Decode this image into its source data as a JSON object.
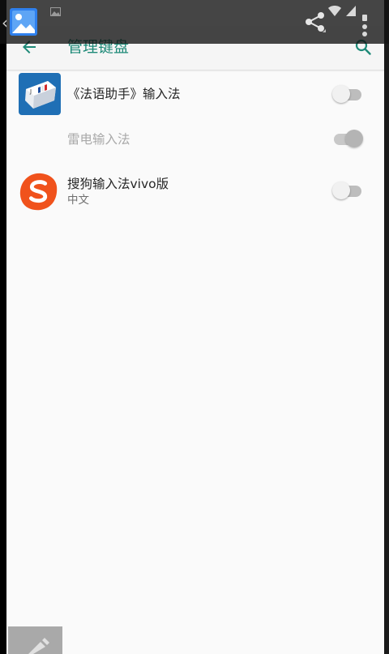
{
  "toolbar": {
    "title": "管理键盘",
    "back_icon": "arrow-left-icon",
    "search_icon": "search-icon"
  },
  "overlay": {
    "share_icon": "share-icon",
    "more_icon": "more-vert-icon",
    "gallery_icon": "gallery-image-icon"
  },
  "keyboards": [
    {
      "label": "《法语助手》输入法",
      "subtitle": "",
      "enabled": false,
      "disabled": false,
      "icon": "fayu-keyboard-icon"
    },
    {
      "label": "雷电输入法",
      "subtitle": "",
      "enabled": true,
      "disabled": true,
      "icon": ""
    },
    {
      "label": "搜狗输入法vivo版",
      "subtitle": "中文",
      "enabled": false,
      "disabled": false,
      "icon": "sogou-s-icon"
    }
  ],
  "colors": {
    "accent": "#1e8a78",
    "background": "#fafafa",
    "sogou_orange": "#f0521c",
    "fayu_blue": "#1f6fb5"
  }
}
